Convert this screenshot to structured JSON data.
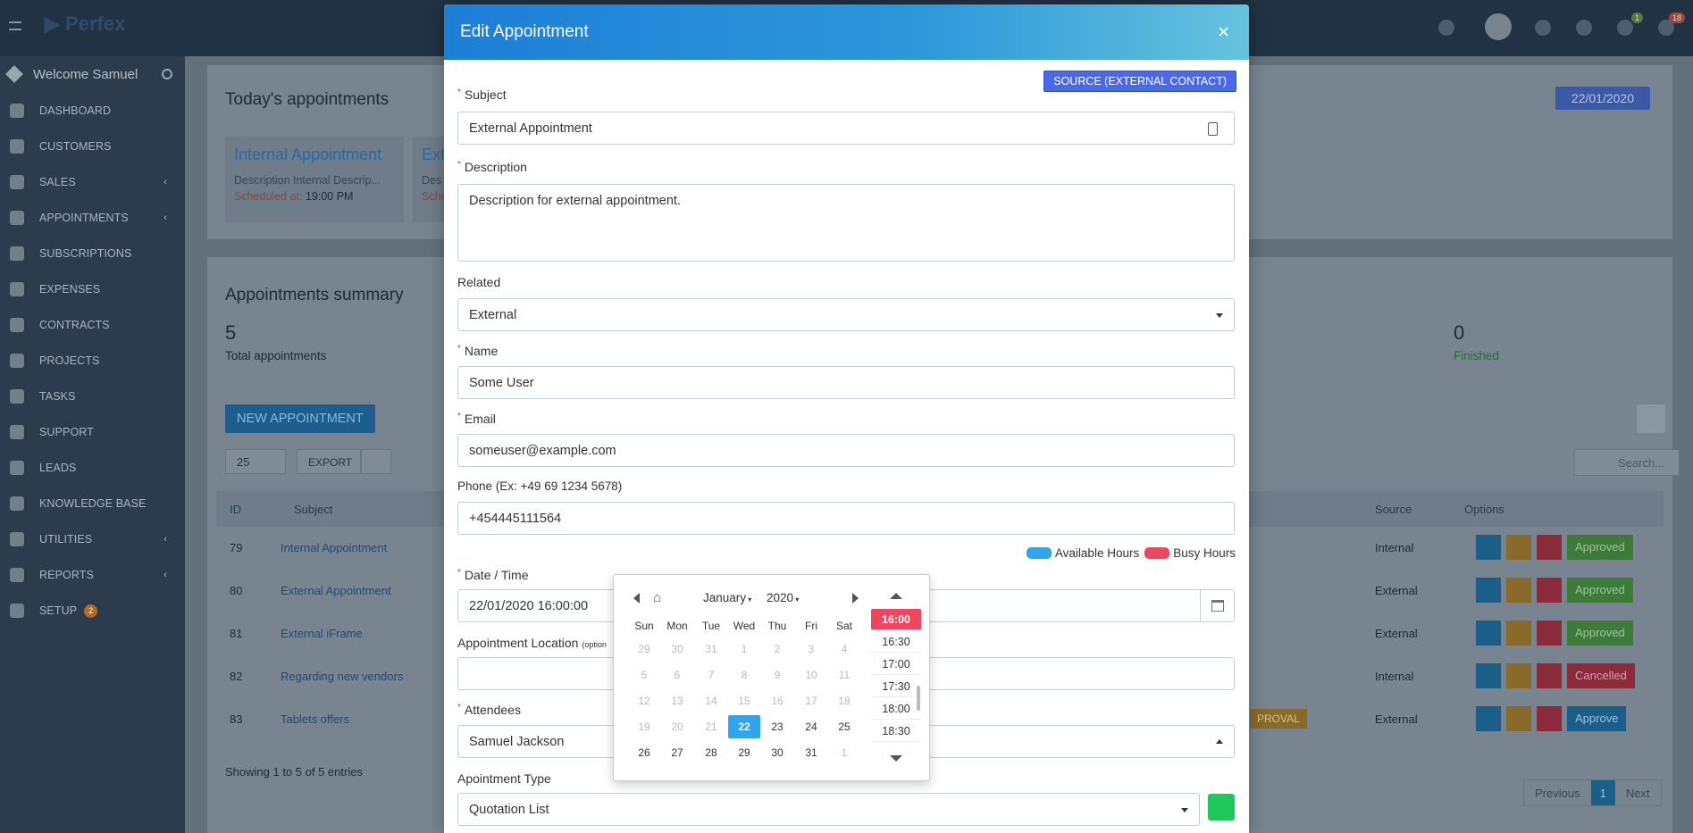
{
  "sidebar": {
    "welcome": "Welcome Samuel",
    "items": [
      {
        "label": "Dashboard",
        "icon": "home-icon"
      },
      {
        "label": "Customers",
        "icon": "user-icon"
      },
      {
        "label": "Sales",
        "icon": "balance-scale-icon"
      },
      {
        "label": "Appointments",
        "icon": "calendar-icon"
      },
      {
        "label": "Subscriptions",
        "icon": "refresh-icon"
      },
      {
        "label": "Expenses",
        "icon": "file-icon"
      },
      {
        "label": "Contracts",
        "icon": "document-icon"
      },
      {
        "label": "Projects",
        "icon": "bars-icon"
      },
      {
        "label": "Tasks",
        "icon": "tasks-icon"
      },
      {
        "label": "Support",
        "icon": "ticket-icon"
      },
      {
        "label": "Leads",
        "icon": "tty-icon"
      },
      {
        "label": "Knowledge Base",
        "icon": "folder-open-icon"
      },
      {
        "label": "Utilities",
        "icon": "cogs-icon"
      },
      {
        "label": "Reports",
        "icon": "area-chart-icon"
      },
      {
        "label": "Setup",
        "icon": "cog-icon"
      }
    ],
    "setup_badge": "2"
  },
  "topbar": {
    "notif1": "1",
    "notif2": "18"
  },
  "bg": {
    "today_title": "Today's appointments",
    "date_badge": "22/01/2020",
    "card1_title": "Internal Appointment",
    "card1_desc": "Description Internal Descrip...",
    "card1_sched_label": "Scheduled at:",
    "card1_sched_time": "19:00 PM",
    "card2_title": "Ext",
    "card2_desc": "Des",
    "card2_sched": "Sche",
    "summary_title": "Appointments summary",
    "total_count": "5",
    "total_label": "Total appointments",
    "finished_count": "0",
    "finished_label": "Finished",
    "new_btn": "NEW APPOINTMENT",
    "page_len": "25",
    "export_btn": "EXPORT",
    "search_placeholder": "Search...",
    "col_id": "ID",
    "col_subject": "Subject",
    "col_source": "Source",
    "col_options": "Options",
    "rows": [
      {
        "id": "79",
        "subject": "Internal Appointment",
        "source": "Internal",
        "status": "Approved"
      },
      {
        "id": "80",
        "subject": "External Appointment",
        "source": "External",
        "status": "Approved"
      },
      {
        "id": "81",
        "subject": "External iFrame",
        "source": "External",
        "status": "Approved"
      },
      {
        "id": "82",
        "subject": "Regarding new vendors",
        "source": "Internal",
        "status": "Cancelled"
      },
      {
        "id": "83",
        "subject": "Tablets offers",
        "source": "External",
        "status": "Approve"
      }
    ],
    "approval_partial": "PROVAL",
    "showing": "Showing 1 to 5 of 5 entries",
    "prev": "Previous",
    "page": "1",
    "next": "Next"
  },
  "modal": {
    "title": "Edit Appointment",
    "source_btn": "SOURCE (EXTERNAL CONTACT)",
    "subject_label": "Subject",
    "subject_value": "External Appointment",
    "description_label": "Description",
    "description_value": "Description for  external appointment.",
    "related_label": "Related",
    "related_value": "External",
    "name_label": "Name",
    "name_value": "Some User",
    "email_label": "Email",
    "email_value": "someuser@example.com",
    "phone_label": "Phone (Ex: +49 69 1234 5678)",
    "phone_value": "+454445111564",
    "available_label": "Available Hours",
    "busy_label": "Busy Hours",
    "available_color": "#2fa4f0",
    "busy_color": "#f0455e",
    "datetime_label": "Date / Time",
    "datetime_value": "22/01/2020 16:00:00",
    "location_label": "Appointment Location",
    "location_optional": "(option",
    "attendees_label": "Attendees",
    "attendees_value": "Samuel Jackson",
    "type_label": "Apointment Type",
    "type_value": "Quotation List",
    "type_color": "#1fc85a"
  },
  "datepicker": {
    "month": "January",
    "year": "2020",
    "weekdays": [
      "Sun",
      "Mon",
      "Tue",
      "Wed",
      "Thu",
      "Fri",
      "Sat"
    ],
    "weeks": [
      [
        "29",
        "30",
        "31",
        "1",
        "2",
        "3",
        "4"
      ],
      [
        "5",
        "6",
        "7",
        "8",
        "9",
        "10",
        "11"
      ],
      [
        "12",
        "13",
        "14",
        "15",
        "16",
        "17",
        "18"
      ],
      [
        "19",
        "20",
        "21",
        "22",
        "23",
        "24",
        "25"
      ],
      [
        "26",
        "27",
        "28",
        "29",
        "30",
        "31",
        "1"
      ]
    ],
    "selected": "22",
    "times": [
      "16:00",
      "16:30",
      "17:00",
      "17:30",
      "18:00",
      "18:30"
    ],
    "selected_time": "16:00"
  }
}
